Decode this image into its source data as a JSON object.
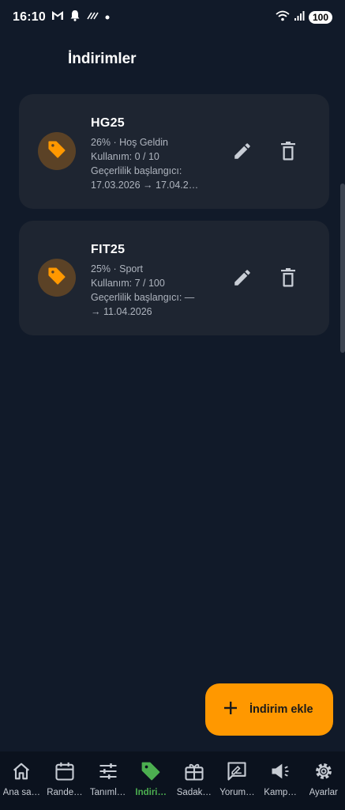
{
  "status_bar": {
    "time": "16:10",
    "battery": "100",
    "icons": [
      "gmail-icon",
      "alarm-icon",
      "nfc-icon",
      "dot-icon",
      "wifi-icon",
      "signal-icon",
      "battery-icon"
    ]
  },
  "page": {
    "title": "İndirimler"
  },
  "discounts": [
    {
      "code": "HG25",
      "summary": "26% · Hoş Geldin",
      "usage": "Kullanım: 0 / 10",
      "validity_label": "Geçerlilik başlangıcı:",
      "validity_range": "17.03.2026 → 17.04.2…",
      "icon": "tag-icon",
      "actions": [
        "edit-icon",
        "delete-icon"
      ]
    },
    {
      "code": "FIT25",
      "summary": "25% · Sport",
      "usage": "Kullanım: 7 / 100",
      "validity_label": "Geçerlilik başlangıcı: —",
      "validity_range": "→ 11.04.2026",
      "icon": "tag-icon",
      "actions": [
        "edit-icon",
        "delete-icon"
      ]
    }
  ],
  "fab": {
    "label": "İndirim ekle",
    "icon": "plus-icon"
  },
  "bottom_nav": [
    {
      "label": "Ana sa…",
      "icon": "home-icon",
      "active": false
    },
    {
      "label": "Rande…",
      "icon": "calendar-icon",
      "active": false
    },
    {
      "label": "Tanıml…",
      "icon": "sliders-icon",
      "active": false
    },
    {
      "label": "İndiri…",
      "icon": "tag-icon",
      "active": true
    },
    {
      "label": "Sadak…",
      "icon": "gift-card-icon",
      "active": false
    },
    {
      "label": "Yorum…",
      "icon": "review-icon",
      "active": false
    },
    {
      "label": "Kamp…",
      "icon": "megaphone-icon",
      "active": false
    },
    {
      "label": "Ayarlar",
      "icon": "gear-icon",
      "active": false
    }
  ],
  "colors": {
    "background": "#111a29",
    "card": "#1e2531",
    "accent": "#ff9800",
    "active_nav": "#4caf50",
    "nav_background": "#0b121e"
  }
}
